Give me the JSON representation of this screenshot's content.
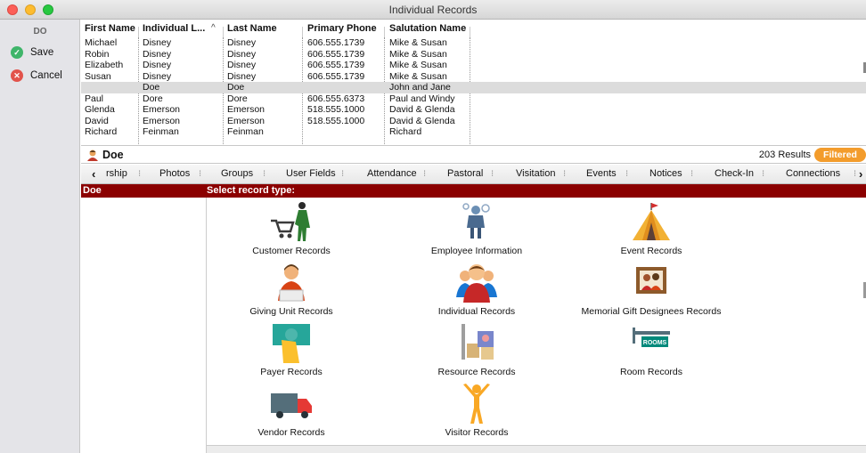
{
  "window": {
    "title": "Individual Records"
  },
  "sidebar": {
    "initials": "DO",
    "save_label": "Save",
    "cancel_label": "Cancel"
  },
  "grid": {
    "columns": [
      "First Name",
      "Individual L...",
      "Last Name",
      "Primary Phone",
      "Salutation Name"
    ],
    "rows": [
      [
        "Michael",
        "Disney",
        "Disney",
        "606.555.1739",
        "Mike & Susan"
      ],
      [
        "Robin",
        "Disney",
        "Disney",
        "606.555.1739",
        "Mike & Susan"
      ],
      [
        "Elizabeth",
        "Disney",
        "Disney",
        "606.555.1739",
        "Mike & Susan"
      ],
      [
        "Susan",
        "Disney",
        "Disney",
        "606.555.1739",
        "Mike & Susan"
      ],
      [
        "",
        "Doe",
        "Doe",
        "",
        "John and Jane"
      ],
      [
        "Paul",
        "Dore",
        "Dore",
        "606.555.6373",
        "Paul and Windy"
      ],
      [
        "Glenda",
        "Emerson",
        "Emerson",
        "518.555.1000",
        "David & Glenda"
      ],
      [
        "David",
        "Emerson",
        "Emerson",
        "518.555.1000",
        "David & Glenda"
      ],
      [
        "Richard",
        "Feinman",
        "Feinman",
        "",
        "Richard"
      ]
    ],
    "selected_row": 4
  },
  "record": {
    "name": "Doe",
    "results": "203 Results",
    "filter_badge": "Filtered"
  },
  "tabs": [
    "rship",
    "Photos",
    "Groups",
    "User Fields",
    "Attendance",
    "Pastoral",
    "Visitation",
    "Events",
    "Notices",
    "Check-In",
    "Connections"
  ],
  "band": {
    "left": "Doe",
    "right": "Select record type:"
  },
  "record_types": [
    {
      "label": "Customer Records",
      "icon": "customer-cart-icon"
    },
    {
      "label": "Employee Information",
      "icon": "employee-icon"
    },
    {
      "label": "Event Records",
      "icon": "event-tent-icon"
    },
    {
      "label": "Giving Unit Records",
      "icon": "giving-unit-icon"
    },
    {
      "label": "Individual Records",
      "icon": "individual-group-icon"
    },
    {
      "label": "Memorial Gift Designees Records",
      "icon": "memorial-frame-icon"
    },
    {
      "label": "Payer Records",
      "icon": "payer-money-icon"
    },
    {
      "label": "Resource Records",
      "icon": "resource-boxes-icon"
    },
    {
      "label": "Room Records",
      "icon": "rooms-sign-icon"
    },
    {
      "label": "Vendor Records",
      "icon": "vendor-truck-icon"
    },
    {
      "label": "Visitor Records",
      "icon": "visitor-person-icon"
    }
  ],
  "colors": {
    "band": "#8b0000",
    "filtered": "#f39c2c",
    "save": "#3fb56a",
    "cancel": "#e2534b"
  }
}
